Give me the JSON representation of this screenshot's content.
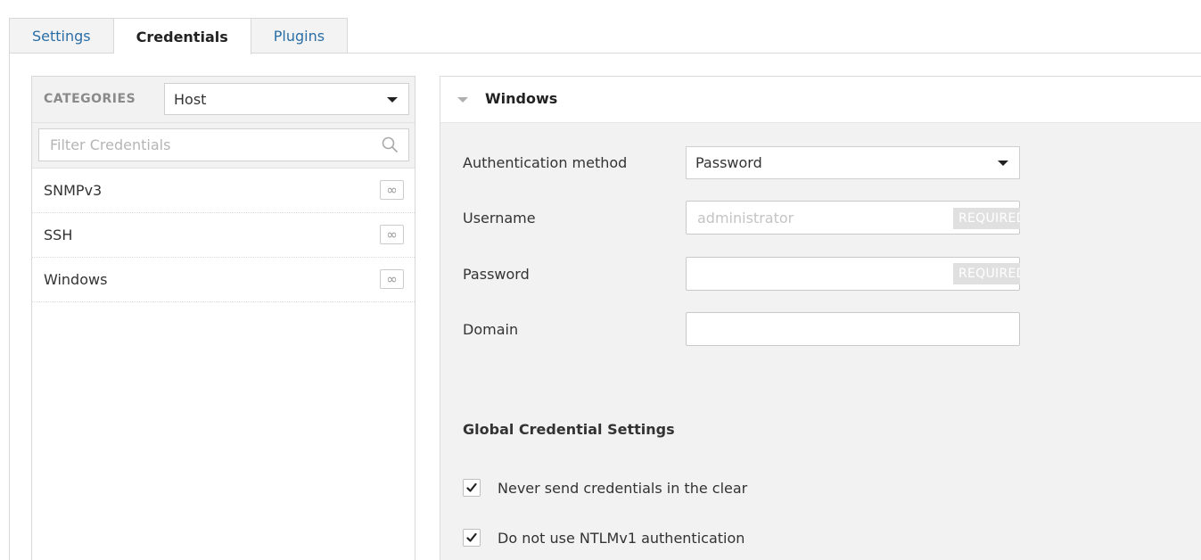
{
  "tabs": [
    {
      "label": "Settings",
      "active": false
    },
    {
      "label": "Credentials",
      "active": true
    },
    {
      "label": "Plugins",
      "active": false
    }
  ],
  "left_panel": {
    "categories_label": "CATEGORIES",
    "category_selected": "Host",
    "filter_placeholder": "Filter Credentials",
    "items": [
      {
        "label": "SNMPv3",
        "icon": "infinity-icon"
      },
      {
        "label": "SSH",
        "icon": "infinity-icon"
      },
      {
        "label": "Windows",
        "icon": "infinity-icon"
      }
    ]
  },
  "right_panel": {
    "title": "Windows",
    "fields": {
      "auth_method_label": "Authentication method",
      "auth_method_value": "Password",
      "username_label": "Username",
      "username_placeholder": "administrator",
      "username_value": "",
      "password_label": "Password",
      "password_value": "",
      "domain_label": "Domain",
      "domain_value": "",
      "required_badge": "REQUIRED"
    },
    "global_settings": {
      "heading": "Global Credential Settings",
      "options": [
        {
          "label": "Never send credentials in the clear",
          "checked": true
        },
        {
          "label": "Do not use NTLMv1 authentication",
          "checked": true
        }
      ]
    }
  },
  "colors": {
    "link_blue": "#2a6ea6",
    "panel_bg": "#f2f2f2",
    "border": "#d8d8d8"
  }
}
